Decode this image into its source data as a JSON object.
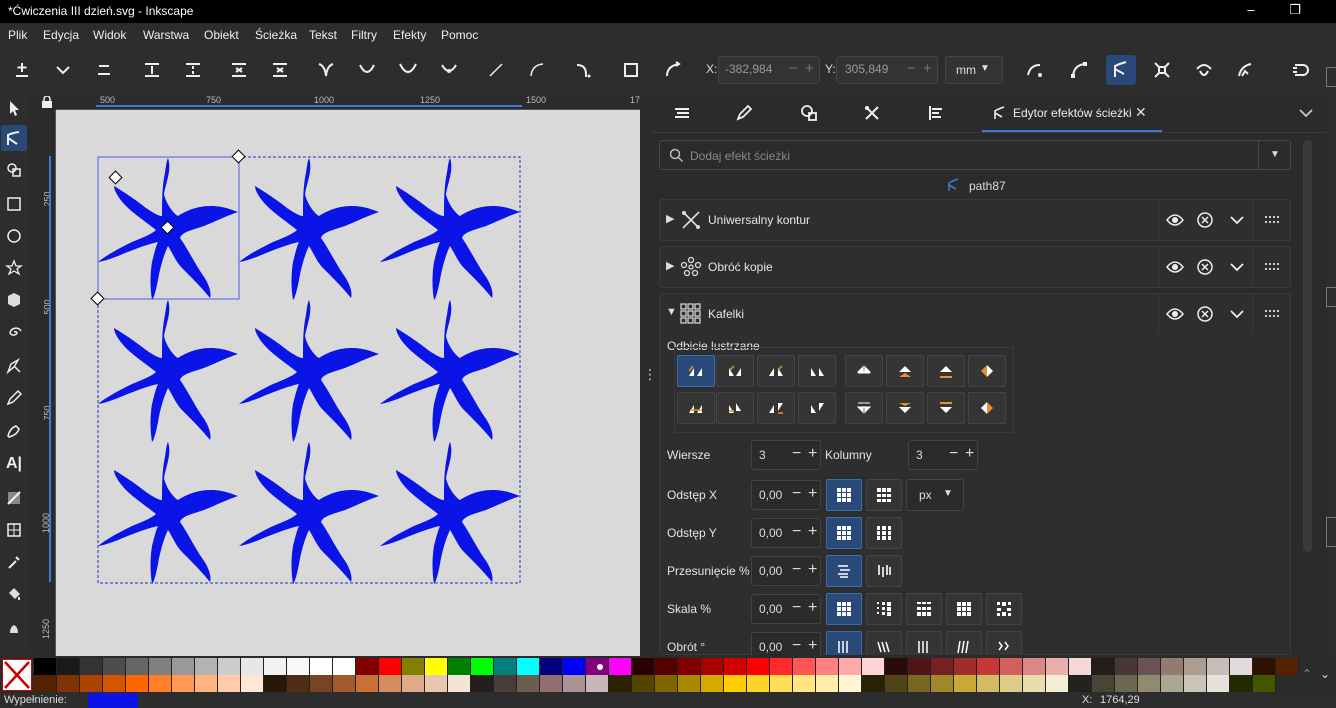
{
  "window": {
    "title": "*Ćwiczenia III dzień.svg - Inkscape"
  },
  "menu": [
    "Plik",
    "Edycja",
    "Widok",
    "Warstwa",
    "Obiekt",
    "Ścieżka",
    "Tekst",
    "Filtry",
    "Efekty",
    "Pomoc"
  ],
  "toolbar": {
    "x_label": "X:",
    "x_value": "-382,984",
    "y_label": "Y:",
    "y_value": "305,849",
    "unit": "mm"
  },
  "ruler": {
    "h_labels": [
      "500",
      "750",
      "1000",
      "1250",
      "1500",
      "17"
    ],
    "v_labels": [
      "250",
      "500",
      "750",
      "1000",
      "1250"
    ]
  },
  "dock": {
    "active_tab": "Edytor efektów ścieżki",
    "search_placeholder": "Dodaj efekt ścieżki",
    "path_name": "path87",
    "effects": [
      "Uniwersalny kontur",
      "Obróć kopie",
      "Kafelki"
    ],
    "mirror_label": "Odbicie lustrzane",
    "rows_label": "Wiersze",
    "rows_value": "3",
    "cols_label": "Kolumny",
    "cols_value": "3",
    "gapx_label": "Odstęp X",
    "gapx_value": "0,00",
    "gapy_label": "Odstęp Y",
    "gapy_value": "0,00",
    "offset_label": "Przesunięcie %",
    "offset_value": "0,00",
    "scale_label": "Skala %",
    "scale_value": "0,00",
    "rotate_label": "Obrót °",
    "rotate_value": "0,00",
    "unit": "px"
  },
  "status": {
    "fill_label": "Wypełnienie:",
    "x_label": "X:",
    "x_value": "1764,29"
  },
  "colors": {
    "accent": "#294a78",
    "shape": "#0a14e6",
    "page": "#d9d9d9"
  }
}
